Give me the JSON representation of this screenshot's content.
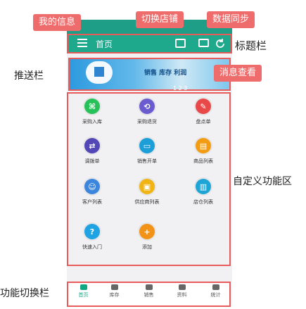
{
  "app_title": "首页",
  "annotations": {
    "my_info": "我的信息",
    "switch_store": "切换店铺",
    "data_sync": "数据同步",
    "title_bar": "标题栏",
    "msg_view": "消息查看",
    "push_bar": "推送栏",
    "custom_area": "自定义功能区",
    "tab_switch": "功能切换栏"
  },
  "banner_text": "销售 库存 利润",
  "banner_pager": "1 2 3",
  "apps": [
    {
      "label": "采购入库",
      "color": "#27c15a",
      "icon": "⌘"
    },
    {
      "label": "采购退货",
      "color": "#6a5bd1",
      "icon": "⟲"
    },
    {
      "label": "盘点单",
      "color": "#e84848",
      "icon": "✎"
    },
    {
      "label": "调拨单",
      "color": "#5347b8",
      "icon": "⇄"
    },
    {
      "label": "销售开单",
      "color": "#1c9ed8",
      "icon": "▭"
    },
    {
      "label": "商品列表",
      "color": "#f39c12",
      "icon": "▤"
    },
    {
      "label": "客户列表",
      "color": "#3d86de",
      "icon": "☺"
    },
    {
      "label": "供应商列表",
      "color": "#f0b514",
      "icon": "▣"
    },
    {
      "label": "店仓列表",
      "color": "#1ea5d6",
      "icon": "▥"
    },
    {
      "label": "快速入门",
      "color": "#1fa3e3",
      "icon": "?"
    },
    {
      "label": "添加",
      "color": "#f29318",
      "icon": "+"
    }
  ],
  "tabs": [
    {
      "label": "首页"
    },
    {
      "label": "库存"
    },
    {
      "label": "销售"
    },
    {
      "label": "资料"
    },
    {
      "label": "统计"
    }
  ]
}
